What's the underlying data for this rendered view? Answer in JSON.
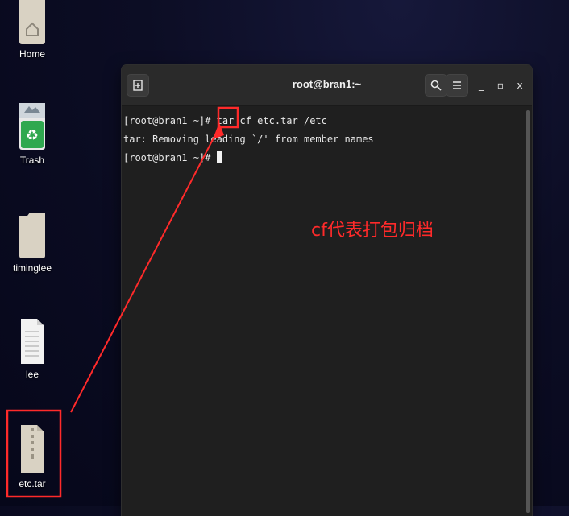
{
  "desktop": {
    "icons": [
      {
        "label": "Home"
      },
      {
        "label": "Trash"
      },
      {
        "label": "timinglee"
      },
      {
        "label": "lee"
      },
      {
        "label": "etc.tar"
      }
    ]
  },
  "terminal": {
    "title": "root@bran1:~",
    "new_tab_glyph": "+",
    "search_glyph": "⚲",
    "menu_glyph": "≡",
    "minimize_glyph": "_",
    "maximize_glyph": "▫",
    "close_glyph": "x",
    "lines": [
      "[root@bran1 ~]# tar cf etc.tar /etc",
      "tar: Removing leading `/' from member names",
      "[root@bran1 ~]# "
    ]
  },
  "annotation": {
    "text": "cf代表打包归档",
    "color": "#ff2a2a"
  }
}
